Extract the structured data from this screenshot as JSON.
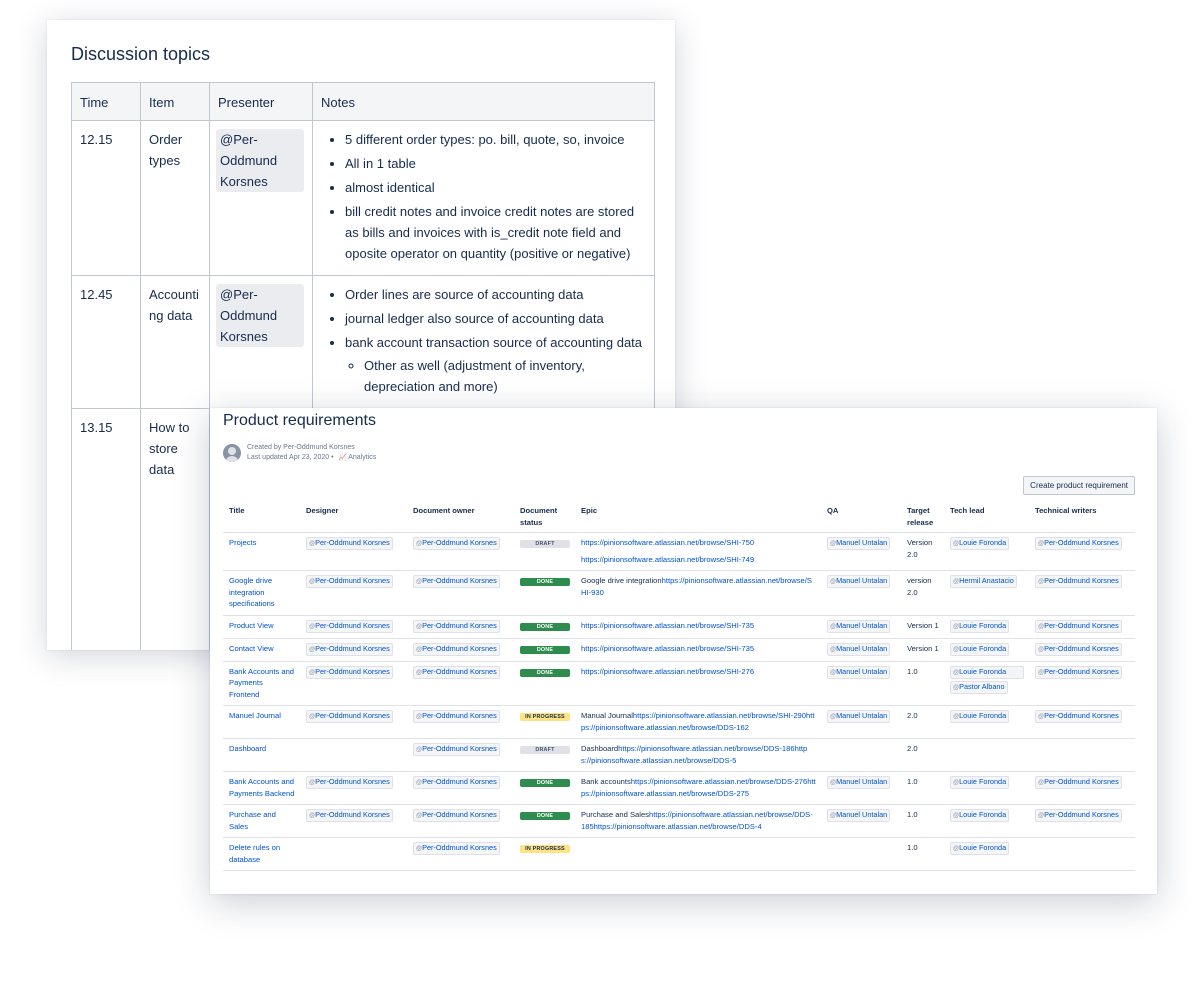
{
  "discussion": {
    "title": "Discussion topics",
    "headers": [
      "Time",
      "Item",
      "Presenter",
      "Notes"
    ],
    "rows": [
      {
        "time": "12.15",
        "item": "Order types",
        "presenter": "@Per-Oddmund Korsnes",
        "notes": [
          "5 different order types: po. bill, quote, so, invoice",
          "All in 1 table",
          "almost identical",
          "bill credit notes and invoice credit notes are stored as bills and invoices with is_credit note field and oposite operator on quantity (positive or negative)"
        ]
      },
      {
        "time": "12.45",
        "item": "Accounting data",
        "presenter": "@Per-Oddmund Korsnes",
        "notes": [
          "Order lines are source of accounting data",
          "journal ledger also source of accounting data",
          "bank account transaction source of accounting data"
        ],
        "subnote": "Other as well (adjustment of inventory, depreciation and more)"
      },
      {
        "time": "13.15",
        "item": "How to store data"
      }
    ]
  },
  "requirements": {
    "title": "Product requirements",
    "created_by": "Created by Per-Oddmund Korsnes",
    "last_updated": "Last updated Apr 23, 2020",
    "separator": "•",
    "analytics_label": "Analytics",
    "create_button": "Create product requirement",
    "headers": {
      "title": "Title",
      "designer": "Designer",
      "owner": "Document owner",
      "status": "Document status",
      "epic": "Epic",
      "qa": "QA",
      "release": "Target release",
      "lead": "Tech lead",
      "writers": "Technical writers"
    },
    "people": {
      "per": "Per-Oddmund Korsnes",
      "manuel": "Manuel Untalan",
      "louie": "Louie Foronda",
      "hermil": "Hermil Anastacio",
      "pastor": "Pastor Albano"
    },
    "rows": [
      {
        "title": "Projects",
        "status": "DRAFT",
        "epic_links": [
          "https://pinionsoftware.atlassian.net/browse/SHI-750",
          "https://pinionsoftware.atlassian.net/browse/SHI-749"
        ],
        "release": "Version 2.0"
      },
      {
        "title": "Google drive integration specifications",
        "status": "DONE",
        "epic_text": "Google drive integration",
        "epic_links": [
          "https://pinionsoftware.atlassian.net/browse/SHI-930"
        ],
        "release": "version 2.0"
      },
      {
        "title": "Product View",
        "status": "DONE",
        "epic_links": [
          "https://pinionsoftware.atlassian.net/browse/SHI-735"
        ],
        "release": "Version 1"
      },
      {
        "title": "Contact View",
        "status": "DONE",
        "epic_links": [
          "https://pinionsoftware.atlassian.net/browse/SHI-735"
        ],
        "release": "Version 1"
      },
      {
        "title": "Bank Accounts and Payments Frontend",
        "status": "DONE",
        "epic_links": [
          "https://pinionsoftware.atlassian.net/browse/SHI-276"
        ],
        "release": "1.0"
      },
      {
        "title": "Manuel Journal",
        "status": "IN PROGRESS",
        "epic_text": "Manual Journal",
        "epic_links": [
          "https://pinionsoftware.atlassian.net/browse/SHI-290",
          "https://pinionsoftware.atlassian.net/browse/DDS-162"
        ],
        "release": "2.0"
      },
      {
        "title": "Dashboard",
        "status": "DRAFT",
        "epic_text": "Dashboard",
        "epic_links": [
          "https://pinionsoftware.atlassian.net/browse/DDS-186",
          "https://pinionsoftware.atlassian.net/browse/DDS-5"
        ],
        "release": "2.0"
      },
      {
        "title": "Bank Accounts and Payments Backend",
        "status": "DONE",
        "epic_text": "Bank accounts",
        "epic_links": [
          "https://pinionsoftware.atlassian.net/browse/DDS-276",
          "https://pinionsoftware.atlassian.net/browse/DDS-275"
        ],
        "release": "1.0"
      },
      {
        "title": "Purchase and Sales",
        "status": "DONE",
        "epic_text": "Purchase and Sales",
        "epic_links": [
          "https://pinionsoftware.atlassian.net/browse/DDS-185",
          "https://pinionsoftware.atlassian.net/browse/DDS-4"
        ],
        "release": "1.0"
      },
      {
        "title": "Delete rules on database",
        "status": "IN PROGRESS",
        "release": "1.0"
      }
    ]
  },
  "colors": {
    "link": "#0052cc",
    "done": "#2f8c4f",
    "draft": "#dfe1e6",
    "in_progress": "#ffe380"
  }
}
